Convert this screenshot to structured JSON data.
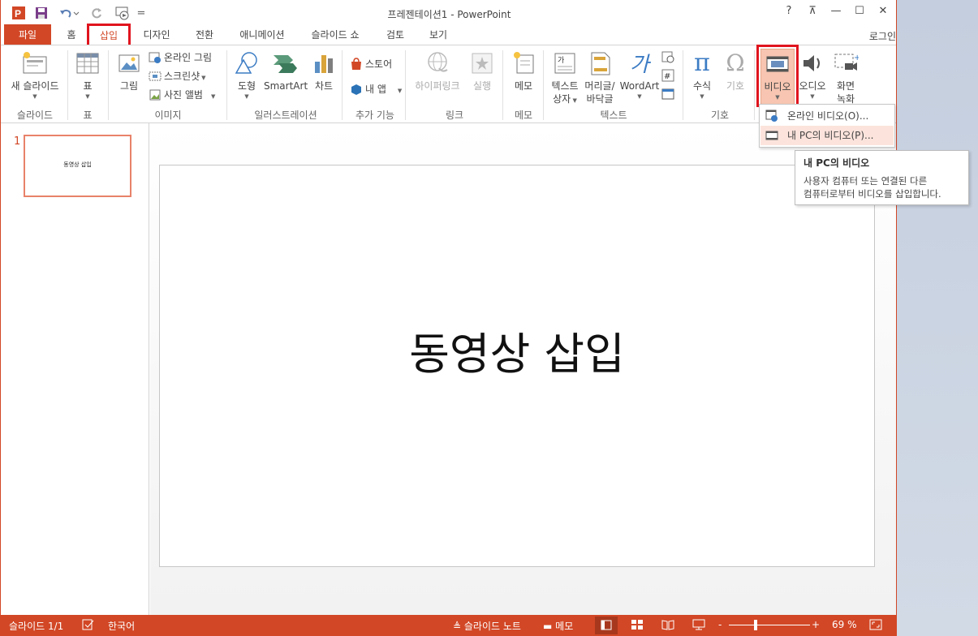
{
  "window": {
    "title": "프레젠테이션1 - PowerPoint",
    "help": "?",
    "restore_ribbon": "⊼",
    "minimize": "—",
    "maximize": "☐",
    "close": "✕"
  },
  "qat": {
    "customize": "="
  },
  "tabs": {
    "file": "파일",
    "items": [
      "홈",
      "삽입",
      "디자인",
      "전환",
      "애니메이션",
      "슬라이드 쇼",
      "검토",
      "보기"
    ],
    "login": "로그인"
  },
  "ribbon": {
    "new_slide": "새 슬라이드",
    "table": "표",
    "picture": "그림",
    "online_picture": "온라인 그림",
    "screenshot": "스크린샷",
    "photo_album": "사진 앨범",
    "shapes": "도형",
    "smartart": "SmartArt",
    "chart": "차트",
    "store": "스토어",
    "my_apps": "내 앱",
    "hyperlink": "하이퍼링크",
    "action": "실행",
    "comment": "메모",
    "textbox_1": "텍스트",
    "textbox_2": "상자",
    "header_1": "머리글/",
    "header_2": "바닥글",
    "wordart": "WordArt",
    "equation": "수식",
    "symbol": "기호",
    "video": "비디오",
    "audio": "오디오",
    "screen_1": "화면",
    "screen_2": "녹화",
    "groups": {
      "slides": "슬라이드",
      "tables": "표",
      "images": "이미지",
      "illustrations": "일러스트레이션",
      "addins": "추가 기능",
      "links": "링크",
      "comments": "메모",
      "text": "텍스트",
      "symbols": "기호"
    }
  },
  "video_menu": {
    "online_video": "온라인 비디오(O)...",
    "pc_video": "내 PC의 비디오(P)..."
  },
  "tooltip": {
    "title": "내 PC의 비디오",
    "line1": "사용자 컴퓨터 또는 연결된 다른",
    "line2": "컴퓨터로부터 비디오를 삽입합니다."
  },
  "thumbnail": {
    "number": "1",
    "text": "동영상 삽입"
  },
  "slide": {
    "title": "동영상 삽입"
  },
  "status": {
    "slide_count": "슬라이드 1/1",
    "language": "한국어",
    "notes": "슬라이드 노트",
    "comments": "메모",
    "zoom_minus": "-",
    "zoom_plus": "+",
    "zoom": "69 %"
  },
  "colors": {
    "accent": "#d24726",
    "highlight": "#e0141e",
    "hover": "#fce4dc"
  },
  "zoom_level": 0.69
}
